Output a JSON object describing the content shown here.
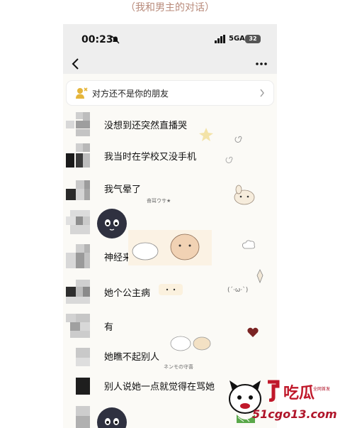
{
  "caption": "（我和男主的对话）",
  "status_bar": {
    "time": "00:23",
    "network": "5GA",
    "battery": "32"
  },
  "banner": {
    "text": "对方还不是你的朋友"
  },
  "messages": [
    {
      "text": "没想到还突然直播哭"
    },
    {
      "text": "我当时在学校又没手机"
    },
    {
      "text": "我气晕了"
    },
    {
      "text": ""
    },
    {
      "text": "神经来的"
    },
    {
      "text": "她个公主病"
    },
    {
      "text": "有"
    },
    {
      "text": "她瞧不起别人"
    },
    {
      "text": "别人说她一点就觉得在骂她"
    }
  ],
  "stickers": {
    "sticker_1": "奋耳ウサ★",
    "sticker_2": "(´·ω·`)",
    "sticker_3": "ネンモの守喜"
  },
  "watermark": {
    "title": "吃瓜",
    "site": "51cgo13.com",
    "small": "全网首发"
  },
  "colors": {
    "caption": "#b88a7a",
    "background": "#fbfaf6",
    "phone_header": "#eeeeee",
    "face": "#2f3140",
    "watermark": "#c0182a"
  }
}
